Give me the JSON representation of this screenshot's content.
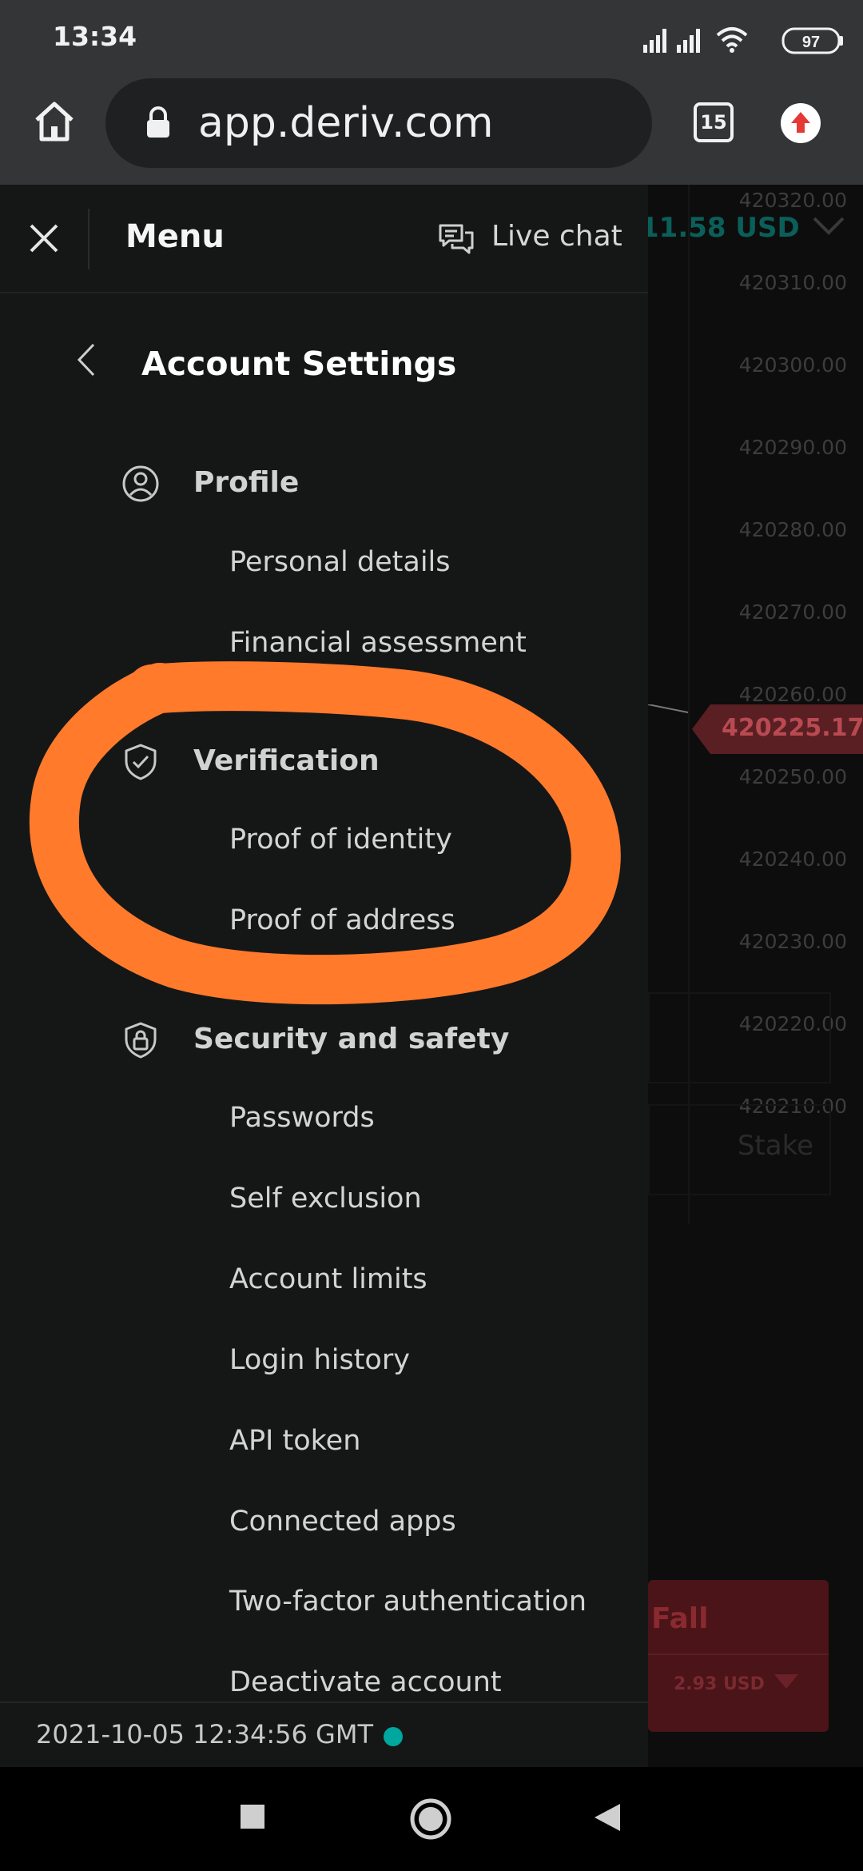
{
  "status_bar": {
    "time": "13:34",
    "battery": "97"
  },
  "browser": {
    "url": "app.deriv.com",
    "tab_count": "15"
  },
  "header": {
    "title": "Menu",
    "live_chat": "Live chat"
  },
  "balance_partial": "11.58 USD",
  "page_title": "Account Settings",
  "sections": [
    {
      "title": "Profile",
      "icon": "profile-icon",
      "items": [
        "Personal details",
        "Financial assessment"
      ]
    },
    {
      "title": "Verification",
      "icon": "shield-check-icon",
      "items": [
        "Proof of identity",
        "Proof of address"
      ]
    },
    {
      "title": "Security and safety",
      "icon": "shield-lock-icon",
      "items": [
        "Passwords",
        "Self exclusion",
        "Account limits",
        "Login history",
        "API token",
        "Connected apps",
        "Two-factor authentication",
        "Deactivate account"
      ]
    }
  ],
  "footer": {
    "timestamp": "2021-10-05 12:34:56 GMT",
    "status_color": "#00a79e"
  },
  "chart": {
    "price_ticks": [
      "420320.00",
      "420310.00",
      "420300.00",
      "420290.00",
      "420280.00",
      "420270.00",
      "420260.00",
      "420250.00",
      "420240.00",
      "420230.00",
      "420220.00",
      "420210.00"
    ],
    "current_price": "420225.17",
    "stake_label": "Stake",
    "fall_label": "Fall",
    "payout": "2.93 USD"
  },
  "colors": {
    "annotation": "#ff7a2b",
    "accent_teal": "#00a79e",
    "price_tag": "#5a1f23",
    "fall_button": "#4a1418"
  }
}
